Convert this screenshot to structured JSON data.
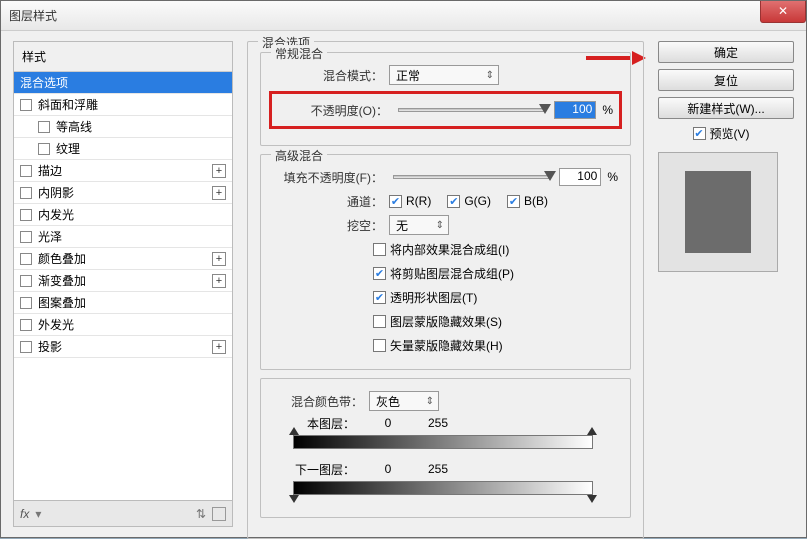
{
  "window": {
    "title": "图层样式"
  },
  "sidebar": {
    "header": "样式",
    "items": [
      {
        "label": "混合选项",
        "selected": true,
        "check": false,
        "hasPlus": false
      },
      {
        "label": "斜面和浮雕",
        "check": true,
        "hasPlus": false
      },
      {
        "label": "等高线",
        "check": true,
        "indent": true,
        "hasPlus": false
      },
      {
        "label": "纹理",
        "check": true,
        "indent": true,
        "hasPlus": false
      },
      {
        "label": "描边",
        "check": true,
        "hasPlus": true
      },
      {
        "label": "内阴影",
        "check": true,
        "hasPlus": true
      },
      {
        "label": "内发光",
        "check": true,
        "hasPlus": false
      },
      {
        "label": "光泽",
        "check": true,
        "hasPlus": false
      },
      {
        "label": "颜色叠加",
        "check": true,
        "hasPlus": true
      },
      {
        "label": "渐变叠加",
        "check": true,
        "hasPlus": true
      },
      {
        "label": "图案叠加",
        "check": true,
        "hasPlus": false
      },
      {
        "label": "外发光",
        "check": true,
        "hasPlus": false
      },
      {
        "label": "投影",
        "check": true,
        "hasPlus": true
      }
    ],
    "bottombar": {
      "fx": "fx"
    }
  },
  "main": {
    "group_title": "混合选项",
    "normal": {
      "legend": "常规混合",
      "mode_label": "混合模式：",
      "mode_value": "正常",
      "opacity_label": "不透明度(O)：",
      "opacity_value": "100",
      "opacity_unit": "%"
    },
    "advanced": {
      "legend": "高级混合",
      "fill_label": "填充不透明度(F)：",
      "fill_value": "100",
      "fill_unit": "%",
      "channel_label": "通道：",
      "channels": {
        "r": "R(R)",
        "g": "G(G)",
        "b": "B(B)"
      },
      "knockout_label": "挖空：",
      "knockout_value": "无",
      "opts": [
        {
          "label": "将内部效果混合成组(I)",
          "checked": false
        },
        {
          "label": "将剪贴图层混合成组(P)",
          "checked": true
        },
        {
          "label": "透明形状图层(T)",
          "checked": true
        },
        {
          "label": "图层蒙版隐藏效果(S)",
          "checked": false
        },
        {
          "label": "矢量蒙版隐藏效果(H)",
          "checked": false
        }
      ]
    },
    "blendif": {
      "label": "混合颜色带：",
      "value": "灰色",
      "this_layer": "本图层：",
      "this_v1": "0",
      "this_v2": "255",
      "next_layer": "下一图层：",
      "next_v1": "0",
      "next_v2": "255"
    }
  },
  "right": {
    "ok": "确定",
    "cancel": "复位",
    "newstyle": "新建样式(W)...",
    "preview": "预览(V)"
  }
}
